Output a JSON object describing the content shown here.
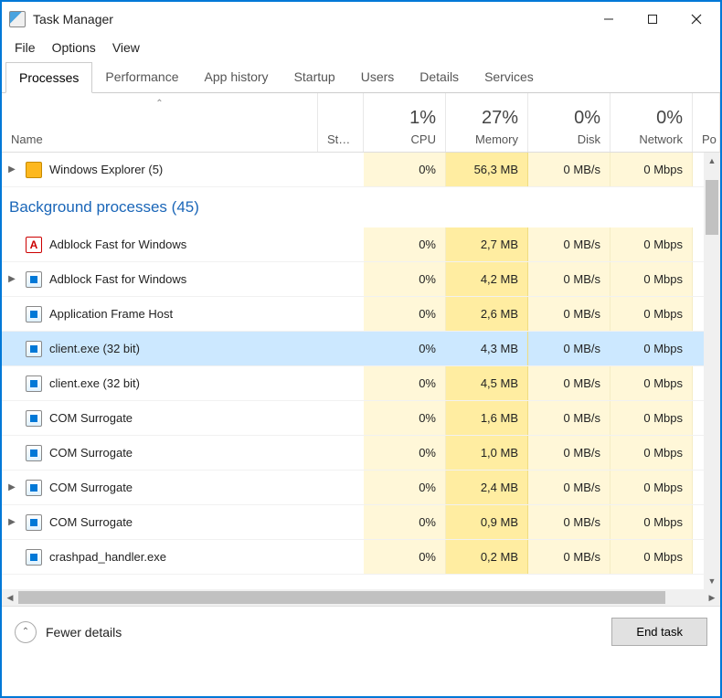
{
  "window": {
    "title": "Task Manager"
  },
  "menubar": [
    "File",
    "Options",
    "View"
  ],
  "tabs": [
    "Processes",
    "Performance",
    "App history",
    "Startup",
    "Users",
    "Details",
    "Services"
  ],
  "active_tab": 0,
  "columns": {
    "name": "Name",
    "status": "St…",
    "cpu": {
      "label": "CPU",
      "summary": "1%"
    },
    "memory": {
      "label": "Memory",
      "summary": "27%"
    },
    "disk": {
      "label": "Disk",
      "summary": "0%"
    },
    "network": {
      "label": "Network",
      "summary": "0%"
    },
    "partial": "Po"
  },
  "group_apps_row": {
    "name": "Windows Explorer (5)",
    "cpu": "0%",
    "memory": "56,3 MB",
    "disk": "0 MB/s",
    "network": "0 Mbps",
    "expandable": true,
    "icon": "folder"
  },
  "group_bg_label": "Background processes (45)",
  "rows": [
    {
      "name": "Adblock Fast for Windows",
      "cpu": "0%",
      "memory": "2,7 MB",
      "disk": "0 MB/s",
      "network": "0 Mbps",
      "expandable": false,
      "icon": "red",
      "selected": false
    },
    {
      "name": "Adblock Fast for Windows",
      "cpu": "0%",
      "memory": "4,2 MB",
      "disk": "0 MB/s",
      "network": "0 Mbps",
      "expandable": true,
      "icon": "app",
      "selected": false
    },
    {
      "name": "Application Frame Host",
      "cpu": "0%",
      "memory": "2,6 MB",
      "disk": "0 MB/s",
      "network": "0 Mbps",
      "expandable": false,
      "icon": "app",
      "selected": false
    },
    {
      "name": "client.exe (32 bit)",
      "cpu": "0%",
      "memory": "4,3 MB",
      "disk": "0 MB/s",
      "network": "0 Mbps",
      "expandable": false,
      "icon": "app",
      "selected": true
    },
    {
      "name": "client.exe (32 bit)",
      "cpu": "0%",
      "memory": "4,5 MB",
      "disk": "0 MB/s",
      "network": "0 Mbps",
      "expandable": false,
      "icon": "app",
      "selected": false
    },
    {
      "name": "COM Surrogate",
      "cpu": "0%",
      "memory": "1,6 MB",
      "disk": "0 MB/s",
      "network": "0 Mbps",
      "expandable": false,
      "icon": "app",
      "selected": false
    },
    {
      "name": "COM Surrogate",
      "cpu": "0%",
      "memory": "1,0 MB",
      "disk": "0 MB/s",
      "network": "0 Mbps",
      "expandable": false,
      "icon": "app",
      "selected": false
    },
    {
      "name": "COM Surrogate",
      "cpu": "0%",
      "memory": "2,4 MB",
      "disk": "0 MB/s",
      "network": "0 Mbps",
      "expandable": true,
      "icon": "app",
      "selected": false
    },
    {
      "name": "COM Surrogate",
      "cpu": "0%",
      "memory": "0,9 MB",
      "disk": "0 MB/s",
      "network": "0 Mbps",
      "expandable": true,
      "icon": "app",
      "selected": false
    },
    {
      "name": "crashpad_handler.exe",
      "cpu": "0%",
      "memory": "0,2 MB",
      "disk": "0 MB/s",
      "network": "0 Mbps",
      "expandable": false,
      "icon": "app",
      "selected": false
    }
  ],
  "footer": {
    "fewer": "Fewer details",
    "endtask": "End task"
  }
}
